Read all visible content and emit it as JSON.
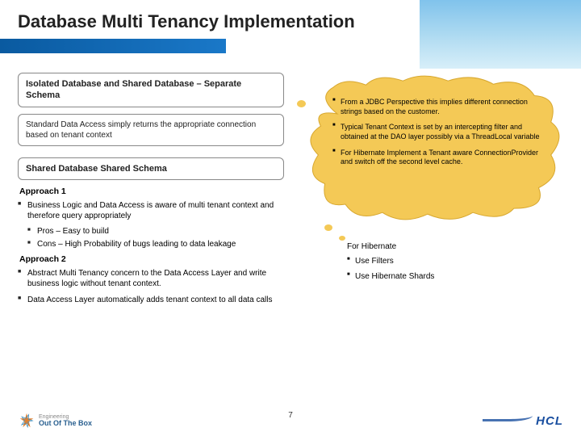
{
  "title": "Database Multi Tenancy Implementation",
  "left": {
    "box1_heading": "Isolated Database and Shared Database – Separate Schema",
    "box1_body": "Standard Data Access simply returns the appropriate connection based on tenant context",
    "box2_heading": "Shared Database Shared Schema",
    "approach1": "Approach 1",
    "a1_b1": "Business Logic and Data Access is aware of multi tenant context and therefore query appropriately",
    "a1_s1": "Pros – Easy to build",
    "a1_s2": "Cons – High Probability of bugs leading to data leakage",
    "approach2": "Approach 2",
    "a2_b1": "Abstract Multi Tenancy concern to the Data Access Layer and write business logic without tenant context.",
    "a2_b2": "Data Access Layer automatically adds tenant context to all data calls"
  },
  "cloud": {
    "c1": "From a JDBC Perspective this implies different connection strings based on the customer.",
    "c2": "Typical Tenant Context is set by an intercepting filter and obtained at the DAO layer possibly via a ThreadLocal variable",
    "c3": "For Hibernate Implement a Tenant aware ConnectionProvider and switch off the second level cache."
  },
  "hibernate": {
    "title": "For Hibernate",
    "b1": "Use Filters",
    "b2": "Use Hibernate Shards"
  },
  "page": "7",
  "logo_oob_top": "Engineering",
  "logo_oob_bottom": "Out Of The Box",
  "logo_hcl": "HCL"
}
